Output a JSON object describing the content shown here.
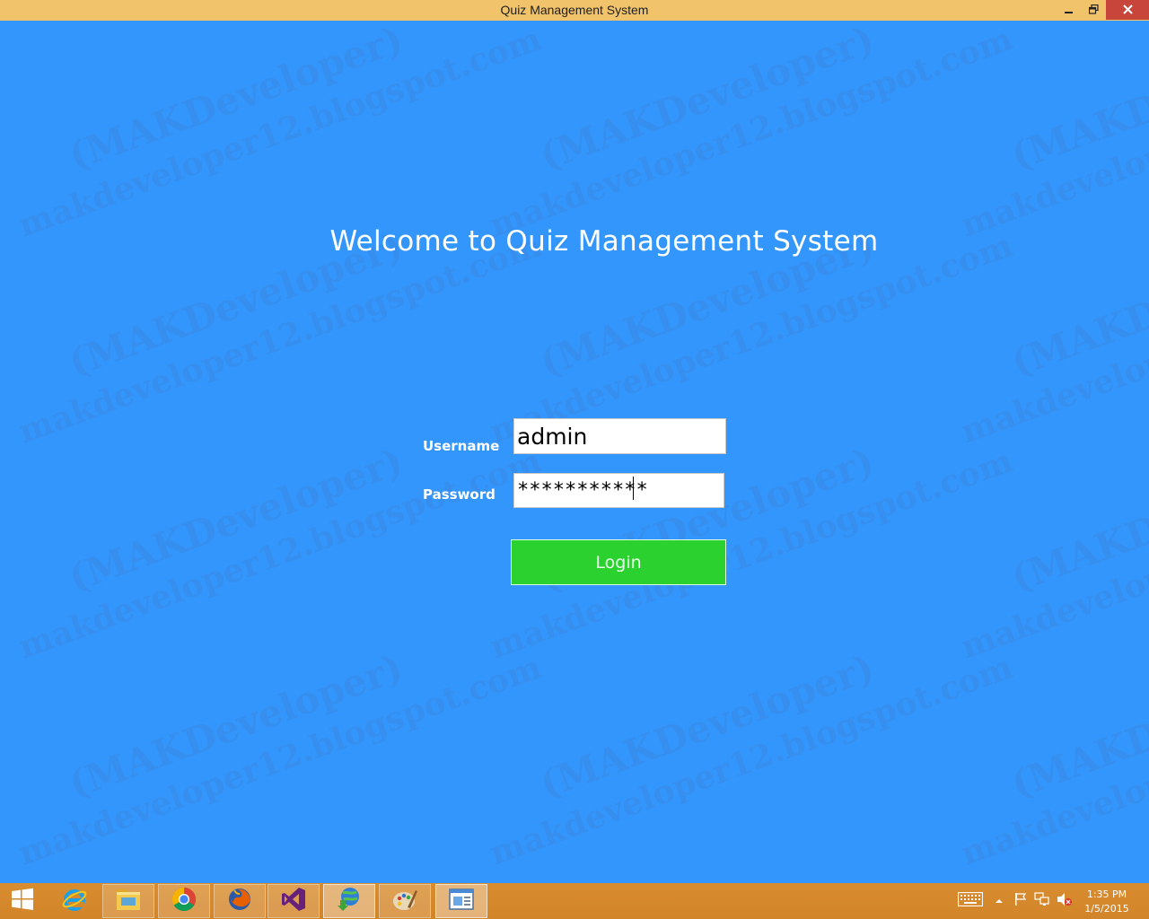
{
  "window": {
    "title": "Quiz Management System"
  },
  "watermark": {
    "line1": "(MAKDeveloper)",
    "line2": "makdeveloper12.blogspot.com"
  },
  "login": {
    "heading": "Welcome to Quiz Management System",
    "username_label": "Username",
    "username_value": "admin",
    "password_label": "Password",
    "password_value": "***********",
    "button_label": "Login"
  },
  "taskbar": {
    "items": [
      {
        "name": "internet-explorer-icon"
      },
      {
        "name": "file-explorer-icon"
      },
      {
        "name": "chrome-icon"
      },
      {
        "name": "firefox-icon"
      },
      {
        "name": "visual-studio-icon"
      },
      {
        "name": "internet-download-manager-icon"
      },
      {
        "name": "paint-icon"
      },
      {
        "name": "quiz-app-icon"
      }
    ],
    "clock": {
      "time": "1:35 PM",
      "date": "1/5/2015"
    }
  },
  "colors": {
    "background": "#3396fc",
    "titlebar": "#f1c46c",
    "login_button": "#2bd12e",
    "taskbar": "#d58829"
  }
}
